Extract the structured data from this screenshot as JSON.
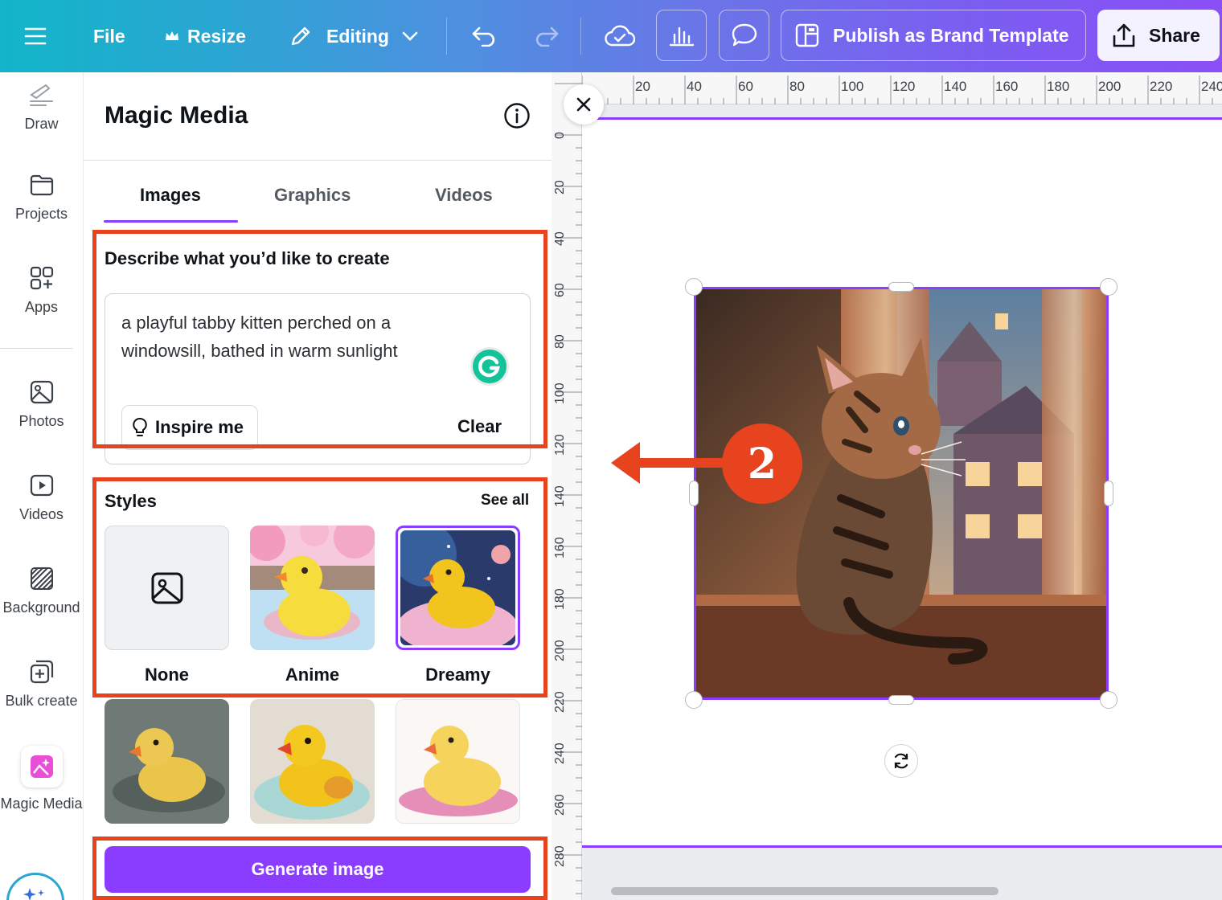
{
  "topbar": {
    "menu_icon": "hamburger-icon",
    "file_label": "File",
    "resize_label": "Resize",
    "editing_label": "Editing",
    "publish_label": "Publish as Brand Template",
    "share_label": "Share"
  },
  "rail": {
    "items": [
      {
        "label": "Draw",
        "icon": "draw-icon"
      },
      {
        "label": "Projects",
        "icon": "folder-icon"
      },
      {
        "label": "Apps",
        "icon": "apps-icon"
      },
      {
        "label": "Photos",
        "icon": "photo-icon"
      },
      {
        "label": "Videos",
        "icon": "video-icon"
      },
      {
        "label": "Background",
        "icon": "background-icon"
      },
      {
        "label": "Bulk create",
        "icon": "bulk-create-icon"
      },
      {
        "label": "Magic Media",
        "icon": "magic-media-icon"
      }
    ]
  },
  "panel": {
    "title": "Magic Media",
    "tabs": [
      "Images",
      "Graphics",
      "Videos"
    ],
    "active_tab": "Images",
    "describe_label": "Describe what you’d like to create",
    "prompt_value": "a playful tabby kitten perched on a windowsill, bathed in warm sunlight",
    "inspire_label": "Inspire me",
    "clear_label": "Clear",
    "styles_label": "Styles",
    "see_all_label": "See all",
    "styles": [
      {
        "label": "None",
        "selected": false
      },
      {
        "label": "Anime",
        "selected": false
      },
      {
        "label": "Dreamy",
        "selected": true
      }
    ],
    "generate_label": "Generate image"
  },
  "canvas": {
    "ruler_top": [
      "20",
      "40",
      "60",
      "80",
      "100",
      "120",
      "140",
      "160",
      "180",
      "200",
      "220",
      "240"
    ],
    "ruler_left": [
      "0",
      "20",
      "40",
      "60",
      "80",
      "100",
      "120",
      "140",
      "160",
      "180",
      "200",
      "220",
      "240",
      "260",
      "280"
    ],
    "step_number": "2"
  },
  "colors": {
    "accent": "#8b3dff",
    "highlight": "#e8431f"
  }
}
